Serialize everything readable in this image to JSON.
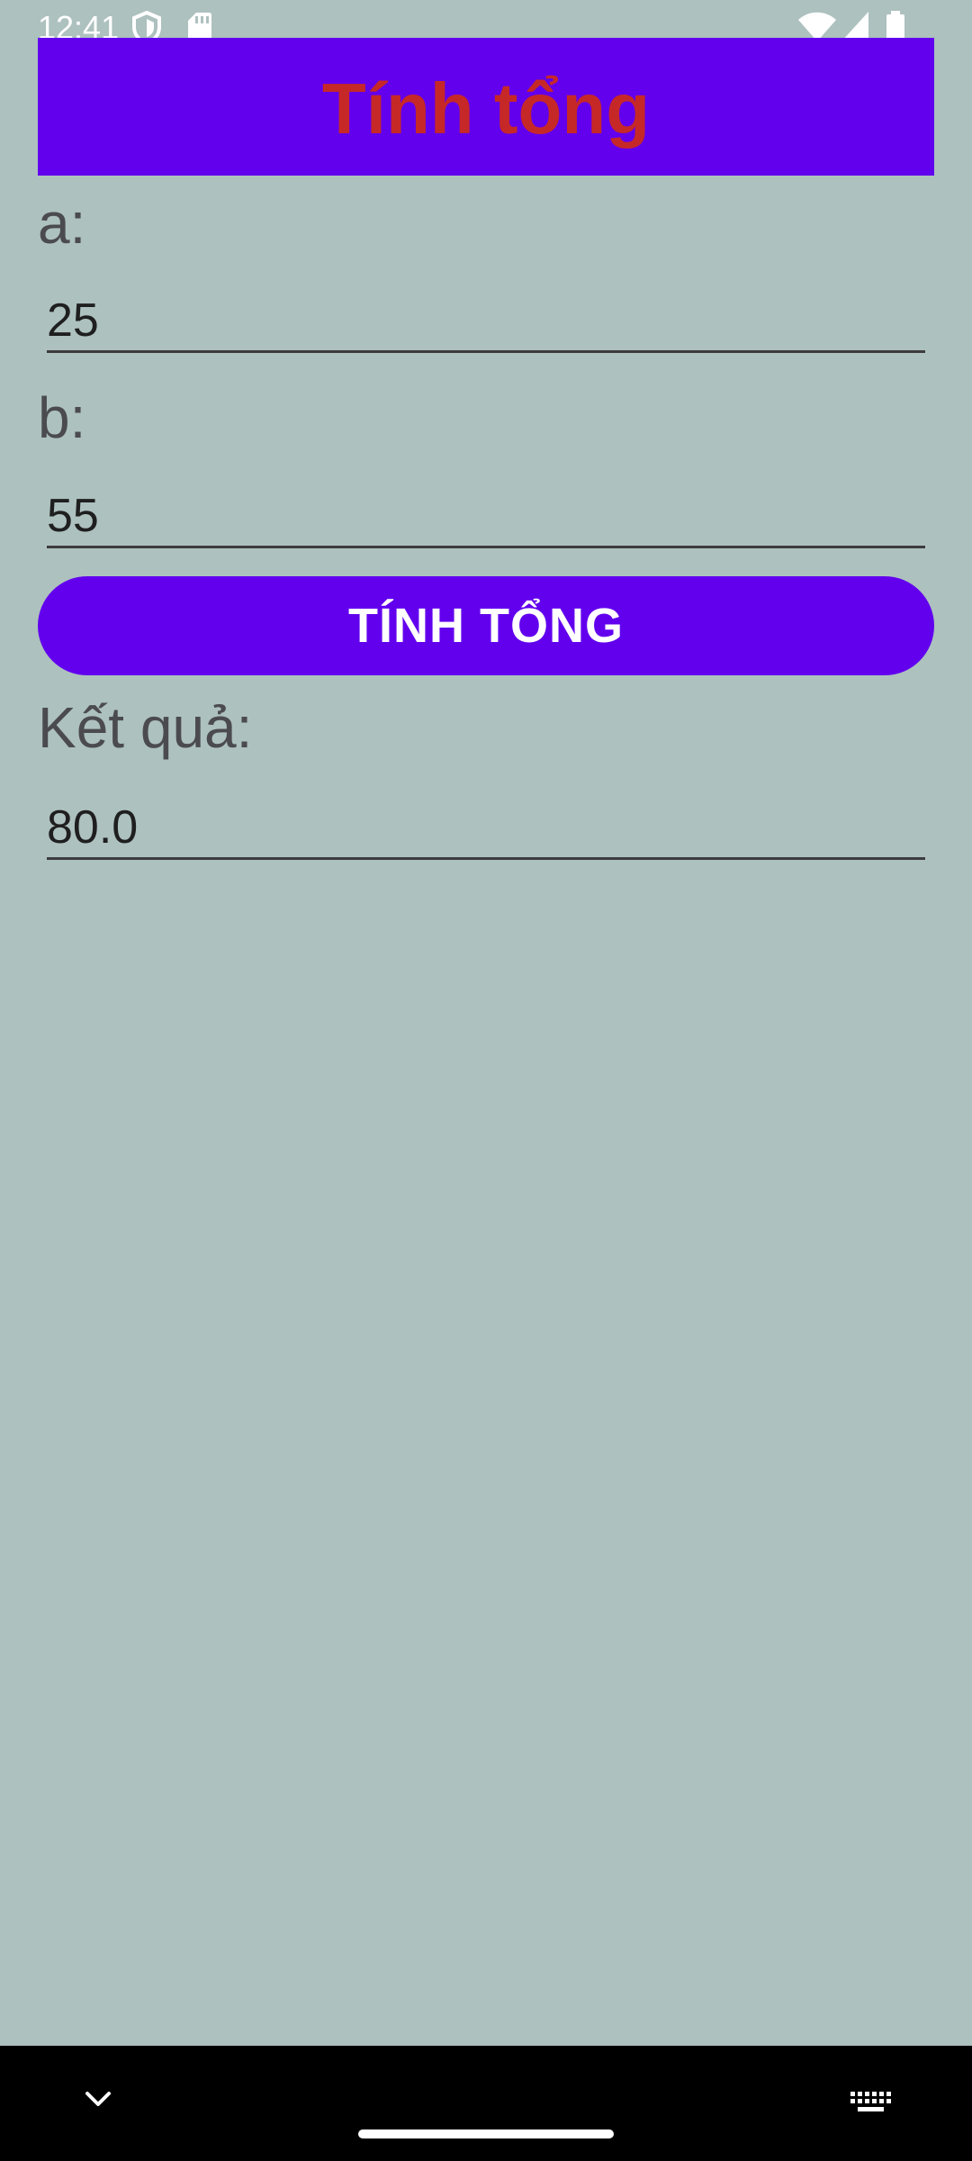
{
  "status_bar": {
    "time": "12:41",
    "icons": [
      "shield-icon",
      "sd-card-icon",
      "wifi-icon",
      "signal-icon",
      "battery-icon"
    ]
  },
  "header": {
    "title": "Tính tổng"
  },
  "form": {
    "a_label": "a:",
    "a_value": "25",
    "b_label": "b:",
    "b_value": "55",
    "button_label": "TÍNH TỔNG",
    "result_label": "Kết quả:",
    "result_value": "80.0"
  },
  "nav_bar": {
    "icons": [
      "chevron-down-icon",
      "keyboard-icon"
    ]
  },
  "colors": {
    "background": "#adc1bf",
    "primary": "#6200ee",
    "title_text": "#c62828",
    "label_text": "#4b4b4f"
  }
}
